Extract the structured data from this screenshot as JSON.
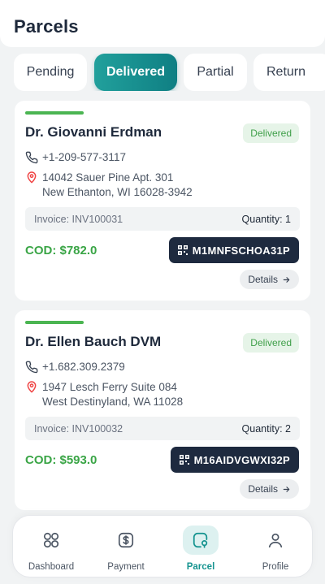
{
  "header": {
    "title": "Parcels"
  },
  "tabs": [
    {
      "label": "Pending",
      "active": false
    },
    {
      "label": "Delivered",
      "active": true
    },
    {
      "label": "Partial",
      "active": false
    },
    {
      "label": "Return",
      "active": false
    }
  ],
  "parcels": [
    {
      "name": "Dr. Giovanni Erdman",
      "status": "Delivered",
      "phone": "+1-209-577-3117",
      "address_line1": "14042 Sauer Pine Apt. 301",
      "address_line2": "New Ethanton, WI 16028-3942",
      "invoice": "Invoice: INV100031",
      "quantity": "Quantity: 1",
      "cod": "COD: $782.0",
      "tracking": "M1MNFSCHOA31P",
      "details_label": "Details"
    },
    {
      "name": "Dr. Ellen Bauch DVM",
      "status": "Delivered",
      "phone": "+1.682.309.2379",
      "address_line1": "1947 Lesch Ferry Suite 084",
      "address_line2": "West Destinyland, WA 11028",
      "invoice": "Invoice: INV100032",
      "quantity": "Quantity: 2",
      "cod": "COD: $593.0",
      "tracking": "M16AIDVGWXI32P",
      "details_label": "Details"
    }
  ],
  "bottom_nav": [
    {
      "label": "Dashboard",
      "icon": "grid-icon",
      "active": false
    },
    {
      "label": "Payment",
      "icon": "dollar-icon",
      "active": false
    },
    {
      "label": "Parcel",
      "icon": "parcel-icon",
      "active": true
    },
    {
      "label": "Profile",
      "icon": "user-icon",
      "active": false
    }
  ],
  "colors": {
    "accent": "#15918d",
    "success": "#3aa546",
    "dark_button": "#1e2a3f",
    "background": "#f1f3f4"
  }
}
